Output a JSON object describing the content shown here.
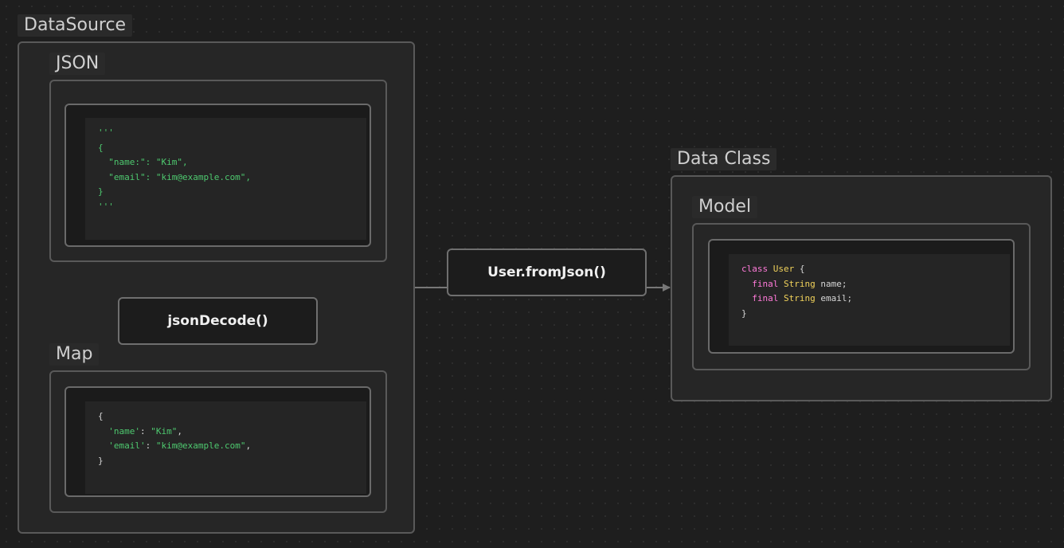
{
  "groups": {
    "datasource": "DataSource",
    "json": "JSON",
    "map": "Map",
    "data_class": "Data Class",
    "model": "Model"
  },
  "nodes": {
    "json_decode": "jsonDecode()",
    "user_from_json": "User.fromJson()"
  },
  "code": {
    "json_block": [
      "'''",
      "{",
      "  \"name:\": \"Kim\",",
      "  \"email\": \"kim@example.com\",",
      "}",
      "'''"
    ],
    "map_block": {
      "open": "{",
      "name_key": "'name'",
      "name_val": "\"Kim\"",
      "email_key": "'email'",
      "email_val": "\"kim@example.com\"",
      "close": "}"
    },
    "model_block": {
      "class_kw": "class",
      "class_name": "User",
      "open": "{",
      "final_kw": "final",
      "type": "String",
      "field1": "name;",
      "field2": "email;",
      "close": "}"
    }
  },
  "colors": {
    "background": "#1e1e1e",
    "string": "#4ec96f",
    "keyword": "#ff7ad9",
    "type": "#f2d35b",
    "edge": "#777777"
  }
}
